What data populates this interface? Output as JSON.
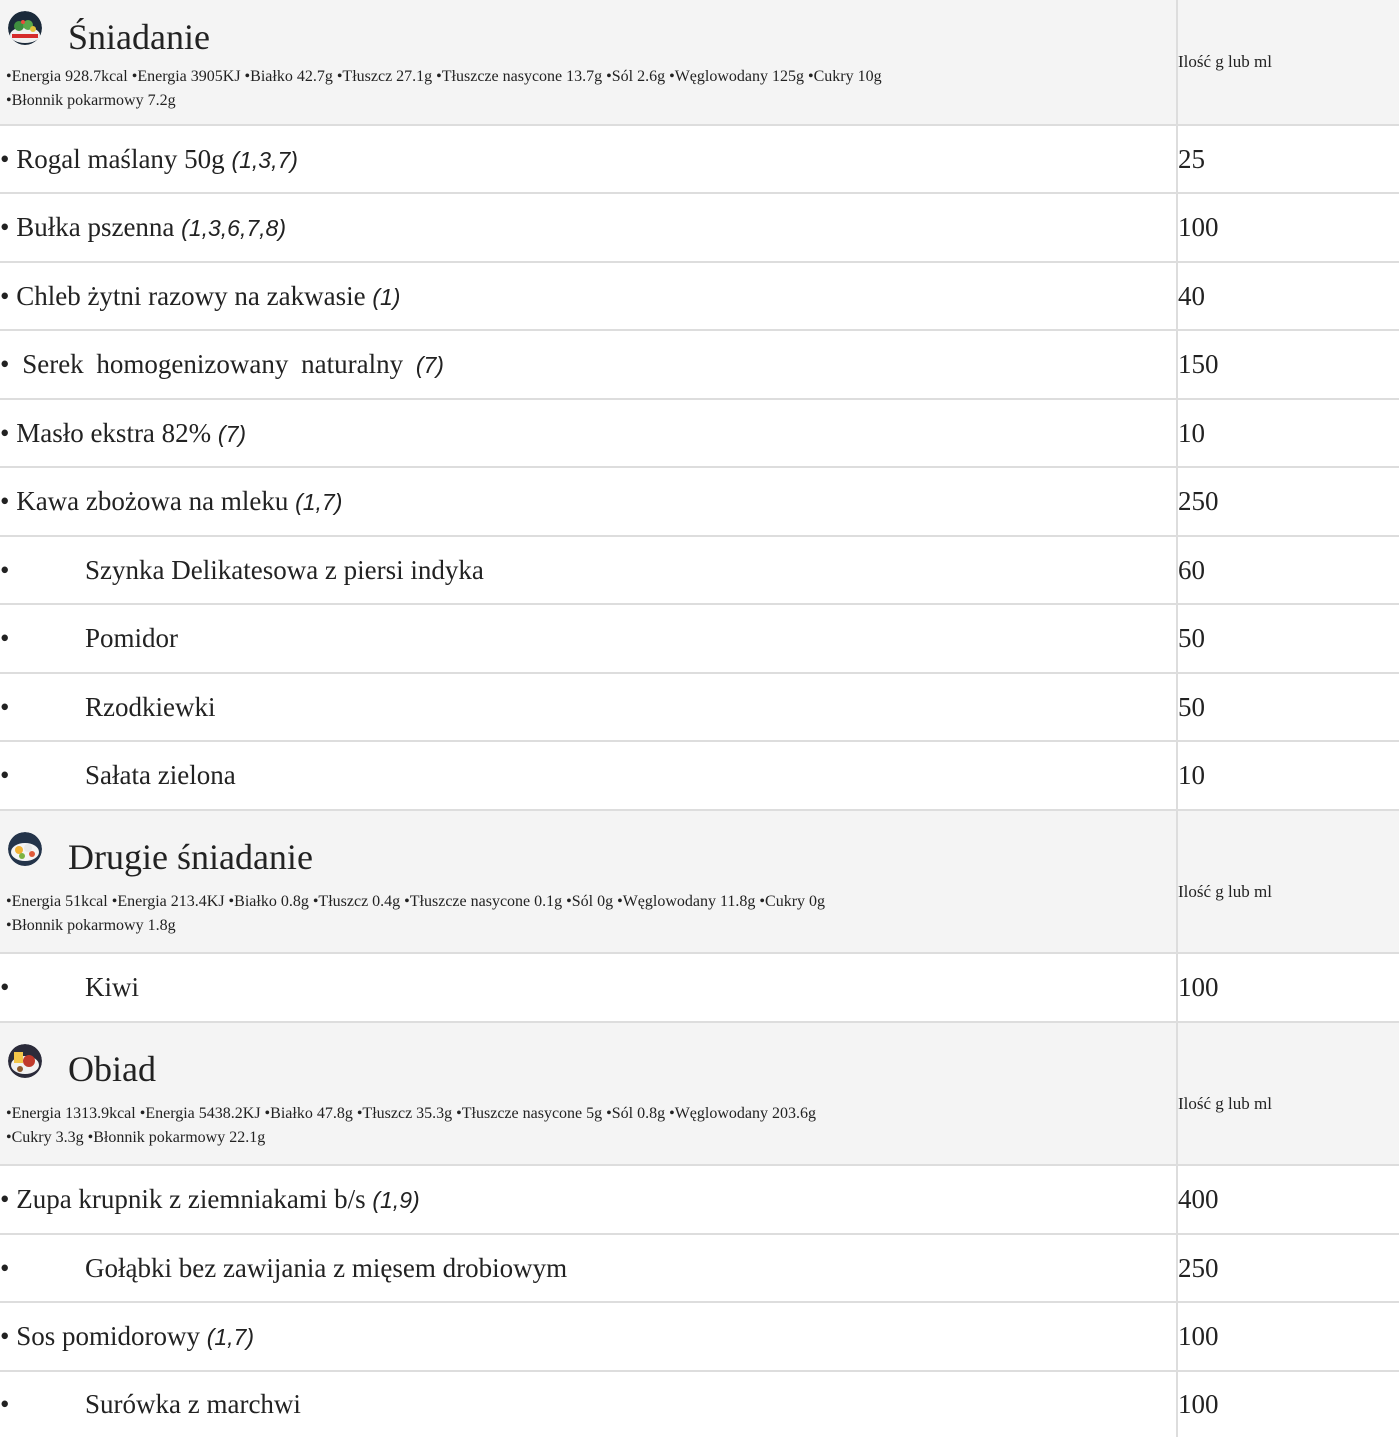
{
  "qty_header": "Ilość g lub ml",
  "meals": [
    {
      "icon": "breakfast-plate-icon",
      "title": "Śniadanie",
      "nutrition_line1": "•Energia 928.7kcal •Energia 3905KJ •Białko 42.7g •Tłuszcz 27.1g •Tłuszcze nasycone 13.7g •Sól 2.6g •Węglowodany 125g •Cukry 10g",
      "nutrition_line2": "•Błonnik pokarmowy 7.2g",
      "items": [
        {
          "name": "• Rogal maślany 50g ",
          "allergens": "(1,3,7)",
          "qty": "25"
        },
        {
          "name": "• Bułka pszenna ",
          "allergens": "(1,3,6,7,8)",
          "qty": "100"
        },
        {
          "name": "• Chleb żytni razowy na zakwasie ",
          "allergens": "(1)",
          "qty": "40"
        },
        {
          "name": "• Serek homogenizowany naturalny ",
          "allergens": "(7)",
          "qty": "150"
        },
        {
          "name": "• Masło ekstra 82% ",
          "allergens": "(7)",
          "qty": "10"
        },
        {
          "name": "• Kawa zbożowa na mleku ",
          "allergens": "(1,7)",
          "qty": "250"
        },
        {
          "bullet": "•",
          "name": "Szynka Delikatesowa z piersi indyka",
          "qty": "60"
        },
        {
          "bullet": "•",
          "name": "Pomidor",
          "qty": "50"
        },
        {
          "bullet": "•",
          "name": "Rzodkiewki",
          "qty": "50"
        },
        {
          "bullet": "•",
          "name": "Sałata zielona",
          "qty": "10"
        }
      ]
    },
    {
      "icon": "second-breakfast-plate-icon",
      "title": "Drugie śniadanie",
      "nutrition_line1": "•Energia 51kcal •Energia 213.4KJ •Białko 0.8g •Tłuszcz 0.4g •Tłuszcze nasycone 0.1g •Sól 0g •Węglowodany 11.8g •Cukry 0g",
      "nutrition_line2": "•Błonnik pokarmowy 1.8g",
      "items": [
        {
          "bullet": "•",
          "name": "Kiwi",
          "qty": "100"
        }
      ]
    },
    {
      "icon": "lunch-plate-icon",
      "title": "Obiad",
      "nutrition_line1": "•Energia 1313.9kcal •Energia 5438.2KJ •Białko 47.8g •Tłuszcz 35.3g •Tłuszcze nasycone 5g •Sól 0.8g •Węglowodany 203.6g",
      "nutrition_line2": "•Cukry 3.3g •Błonnik pokarmowy 22.1g",
      "items": [
        {
          "name": "• Zupa krupnik z ziemniakami b/s ",
          "allergens": "(1,9)",
          "qty": "400"
        },
        {
          "bullet": "•",
          "name": "Gołąbki bez zawijania z mięsem drobiowym",
          "qty": "250"
        },
        {
          "name": "• Sos pomidorowy ",
          "allergens": "(1,7)",
          "qty": "100"
        },
        {
          "bullet": "•",
          "name": "Surówka z marchwi",
          "qty": "100"
        }
      ]
    }
  ]
}
